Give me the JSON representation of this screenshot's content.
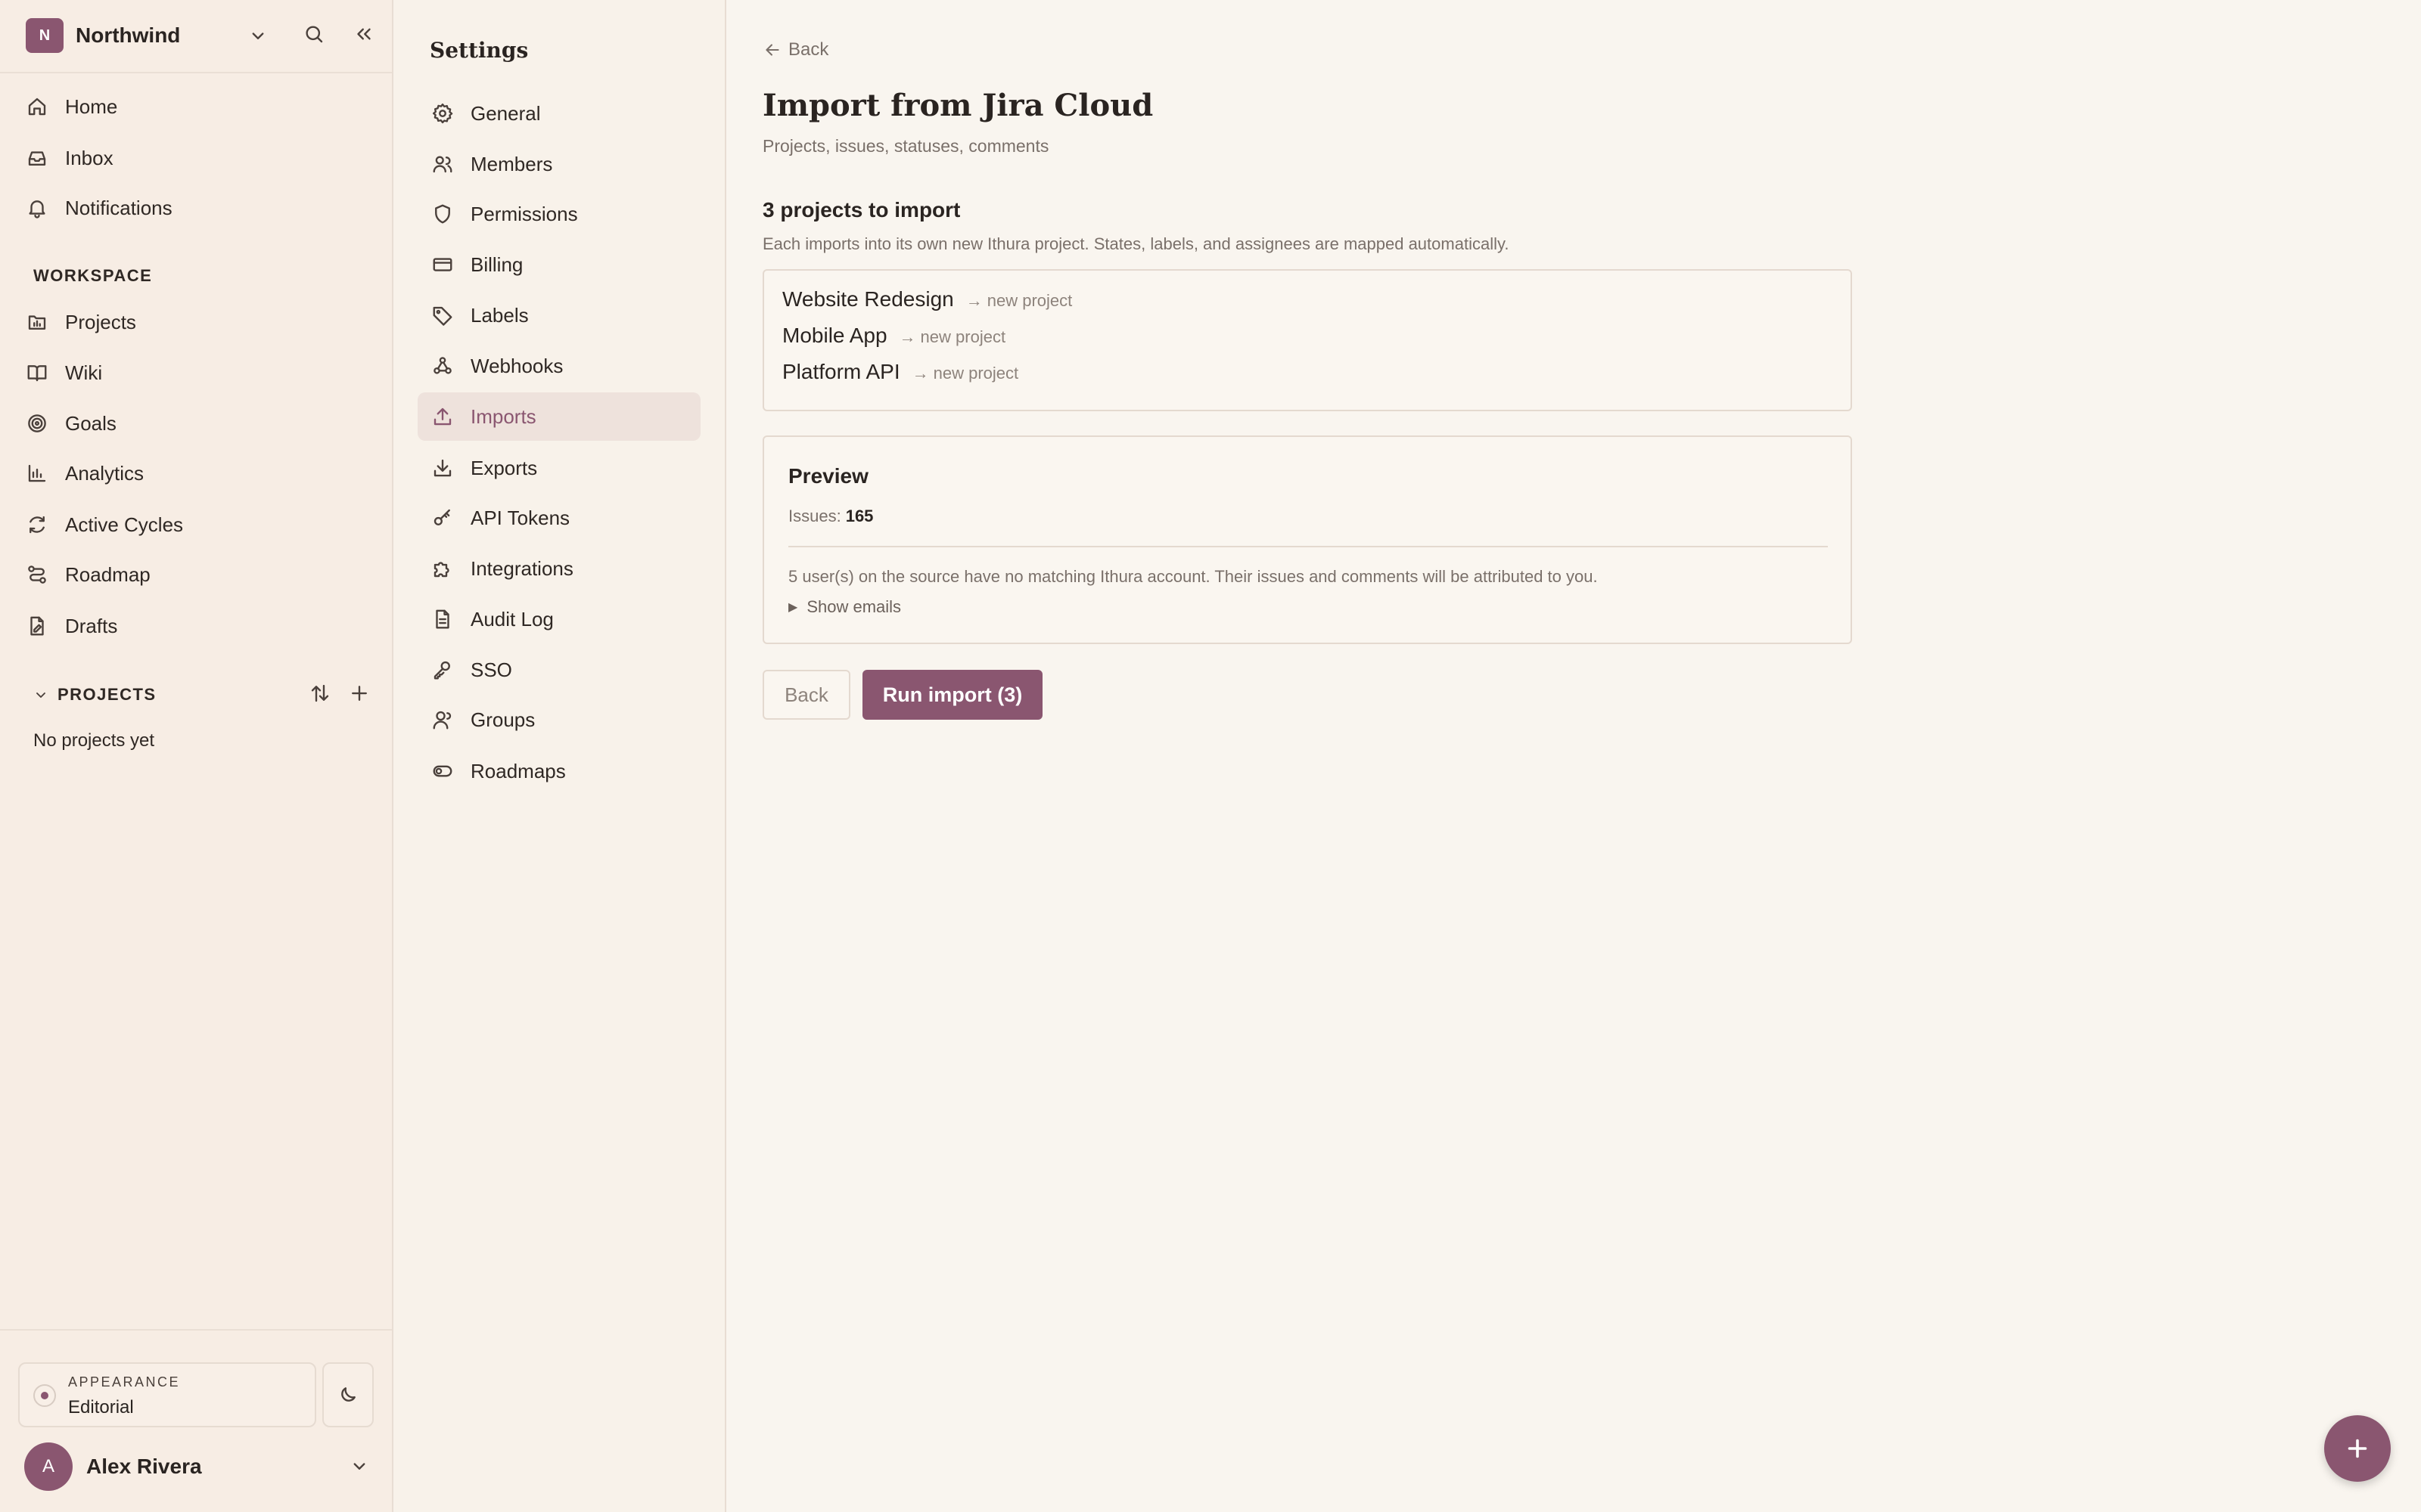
{
  "workspace": {
    "initial": "N",
    "name": "Northwind"
  },
  "nav": {
    "primary": [
      {
        "label": "Home",
        "icon": "home-icon"
      },
      {
        "label": "Inbox",
        "icon": "inbox-icon"
      },
      {
        "label": "Notifications",
        "icon": "bell-icon"
      }
    ],
    "workspace_label": "WORKSPACE",
    "workspace_items": [
      {
        "label": "Projects",
        "icon": "projects-icon"
      },
      {
        "label": "Wiki",
        "icon": "book-icon"
      },
      {
        "label": "Goals",
        "icon": "target-icon"
      },
      {
        "label": "Analytics",
        "icon": "bar-chart-icon"
      },
      {
        "label": "Active Cycles",
        "icon": "refresh-icon"
      },
      {
        "label": "Roadmap",
        "icon": "route-icon"
      },
      {
        "label": "Drafts",
        "icon": "draft-icon"
      }
    ],
    "projects_label": "PROJECTS",
    "no_projects": "No projects yet"
  },
  "appearance": {
    "label": "APPEARANCE",
    "value": "Editorial"
  },
  "user": {
    "initial": "A",
    "name": "Alex Rivera"
  },
  "settings": {
    "title": "Settings",
    "items": [
      {
        "label": "General",
        "icon": "gear-icon"
      },
      {
        "label": "Members",
        "icon": "users-icon"
      },
      {
        "label": "Permissions",
        "icon": "shield-icon"
      },
      {
        "label": "Billing",
        "icon": "credit-card-icon"
      },
      {
        "label": "Labels",
        "icon": "tag-icon"
      },
      {
        "label": "Webhooks",
        "icon": "webhook-icon"
      },
      {
        "label": "Imports",
        "icon": "upload-icon",
        "active": true
      },
      {
        "label": "Exports",
        "icon": "download-icon"
      },
      {
        "label": "API Tokens",
        "icon": "key-icon"
      },
      {
        "label": "Integrations",
        "icon": "puzzle-icon"
      },
      {
        "label": "Audit Log",
        "icon": "file-text-icon"
      },
      {
        "label": "SSO",
        "icon": "sso-key-icon"
      },
      {
        "label": "Groups",
        "icon": "group-icon"
      },
      {
        "label": "Roadmaps",
        "icon": "toggle-icon"
      }
    ]
  },
  "main": {
    "back_link": "Back",
    "title": "Import from Jira Cloud",
    "subtitle": "Projects, issues, statuses, comments",
    "count_title": "3 projects to import",
    "count_sub": "Each imports into its own new Ithura project. States, labels, and assignees are mapped automatically.",
    "projects": [
      {
        "name": "Website Redesign",
        "arrow": "→",
        "target": "new project"
      },
      {
        "name": "Mobile App",
        "arrow": "→",
        "target": "new project"
      },
      {
        "name": "Platform API",
        "arrow": "→",
        "target": "new project"
      }
    ],
    "preview": {
      "title": "Preview",
      "issues_label": "Issues:",
      "issues_count": "165",
      "warning": "5 user(s) on the source have no matching Ithura account. Their issues and comments will be attributed to you.",
      "show_emails_glyph": "▶",
      "show_emails": "Show emails"
    },
    "back_button": "Back",
    "run_button": "Run import (3)"
  },
  "colors": {
    "accent": "#8a5670",
    "background": "#f9f5ef",
    "sidebar": "#f7ede4"
  }
}
